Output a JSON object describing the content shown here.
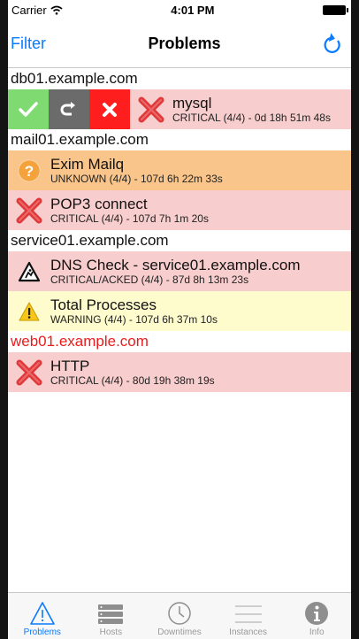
{
  "status_bar": {
    "carrier": "Carrier",
    "time": "4:01 PM"
  },
  "navbar": {
    "filter_label": "Filter",
    "title": "Problems"
  },
  "sections": [
    {
      "host": "db01.example.com",
      "swipe_actions": [
        "acknowledge",
        "reschedule",
        "delete"
      ],
      "items": [
        {
          "name": "mysql",
          "detail": "CRITICAL (4/4) - 0d 18h 51m 48s",
          "state": "critical"
        }
      ]
    },
    {
      "host": "mail01.example.com",
      "items": [
        {
          "name": "Exim Mailq",
          "detail": "UNKNOWN (4/4) - 107d 6h 22m 33s",
          "state": "unknown"
        },
        {
          "name": "POP3 connect",
          "detail": "CRITICAL (4/4) - 107d 7h 1m 20s",
          "state": "critical"
        }
      ]
    },
    {
      "host": "service01.example.com",
      "items": [
        {
          "name": "DNS Check - service01.example.com",
          "detail": "CRITICAL/ACKED (4/4) - 87d 8h 13m 23s",
          "state": "acked"
        },
        {
          "name": "Total Processes",
          "detail": "WARNING (4/4) - 107d 6h 37m 10s",
          "state": "warning"
        }
      ]
    },
    {
      "host": "web01.example.com",
      "host_color": "#ea1c1c",
      "items": [
        {
          "name": "HTTP",
          "detail": "CRITICAL (4/4) - 80d 19h 38m 19s",
          "state": "critical"
        }
      ]
    }
  ],
  "tabs": [
    {
      "label": "Problems",
      "icon": "warning-triangle-icon",
      "active": true
    },
    {
      "label": "Hosts",
      "icon": "server-stack-icon"
    },
    {
      "label": "Downtimes",
      "icon": "clock-icon"
    },
    {
      "label": "Instances",
      "icon": "list-lines-icon"
    },
    {
      "label": "Info",
      "icon": "info-icon"
    }
  ],
  "colors": {
    "accent": "#0a7aff",
    "critical_bg": "#f7cdcd",
    "unknown_bg": "#f9c58a",
    "warning_bg": "#fefbcc"
  }
}
